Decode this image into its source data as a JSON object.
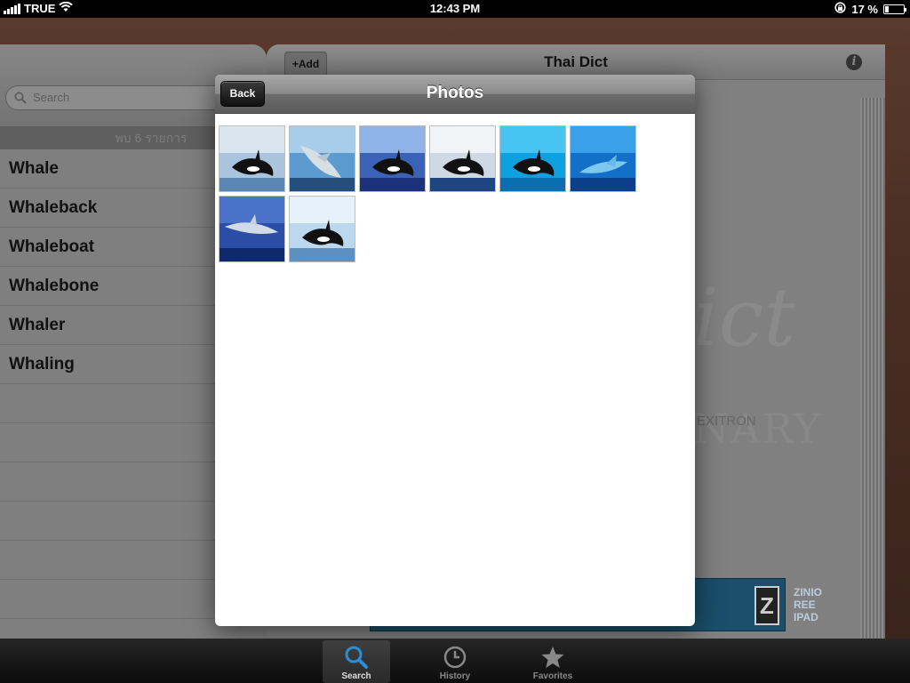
{
  "status_bar": {
    "carrier": "TRUE",
    "time": "12:43 PM",
    "battery": "17 %",
    "battery_level": 0.17
  },
  "left_pane": {
    "search_placeholder": "Search",
    "result_count": "พบ 6 รายการ",
    "words": [
      "Whale",
      "Whaleback",
      "Whaleboat",
      "Whalebone",
      "Whaler",
      "Whaling"
    ]
  },
  "right_pane": {
    "add_label": "+Add",
    "title": "Thai Dict",
    "info_label": "i",
    "ghost_word": "ict",
    "ghost_brand": "EXITRON",
    "ghost_heading": "NARY",
    "ad_text": "ZINIO\nREE\nIPAD",
    "ad_logo": "Z"
  },
  "popover": {
    "back_label": "Back",
    "title": "Photos",
    "photos": [
      {
        "name": "orca-breaching-photo",
        "subject": "orca"
      },
      {
        "name": "humpback-breaching-photo",
        "subject": "humpback"
      },
      {
        "name": "orca-splash-photo",
        "subject": "orca"
      },
      {
        "name": "orca-jumping-photo",
        "subject": "orca"
      },
      {
        "name": "orca-underwater-photo",
        "subject": "orca"
      },
      {
        "name": "blue-whale-photo",
        "subject": "whale"
      },
      {
        "name": "whale-shark-photo",
        "subject": "shark"
      },
      {
        "name": "orca-pod-photo",
        "subject": "orca"
      }
    ]
  },
  "tab_bar": {
    "tabs": [
      {
        "label": "Search",
        "icon": "search-icon",
        "active": true
      },
      {
        "label": "History",
        "icon": "clock-icon",
        "active": false
      },
      {
        "label": "Favorites",
        "icon": "star-icon",
        "active": false
      }
    ]
  }
}
